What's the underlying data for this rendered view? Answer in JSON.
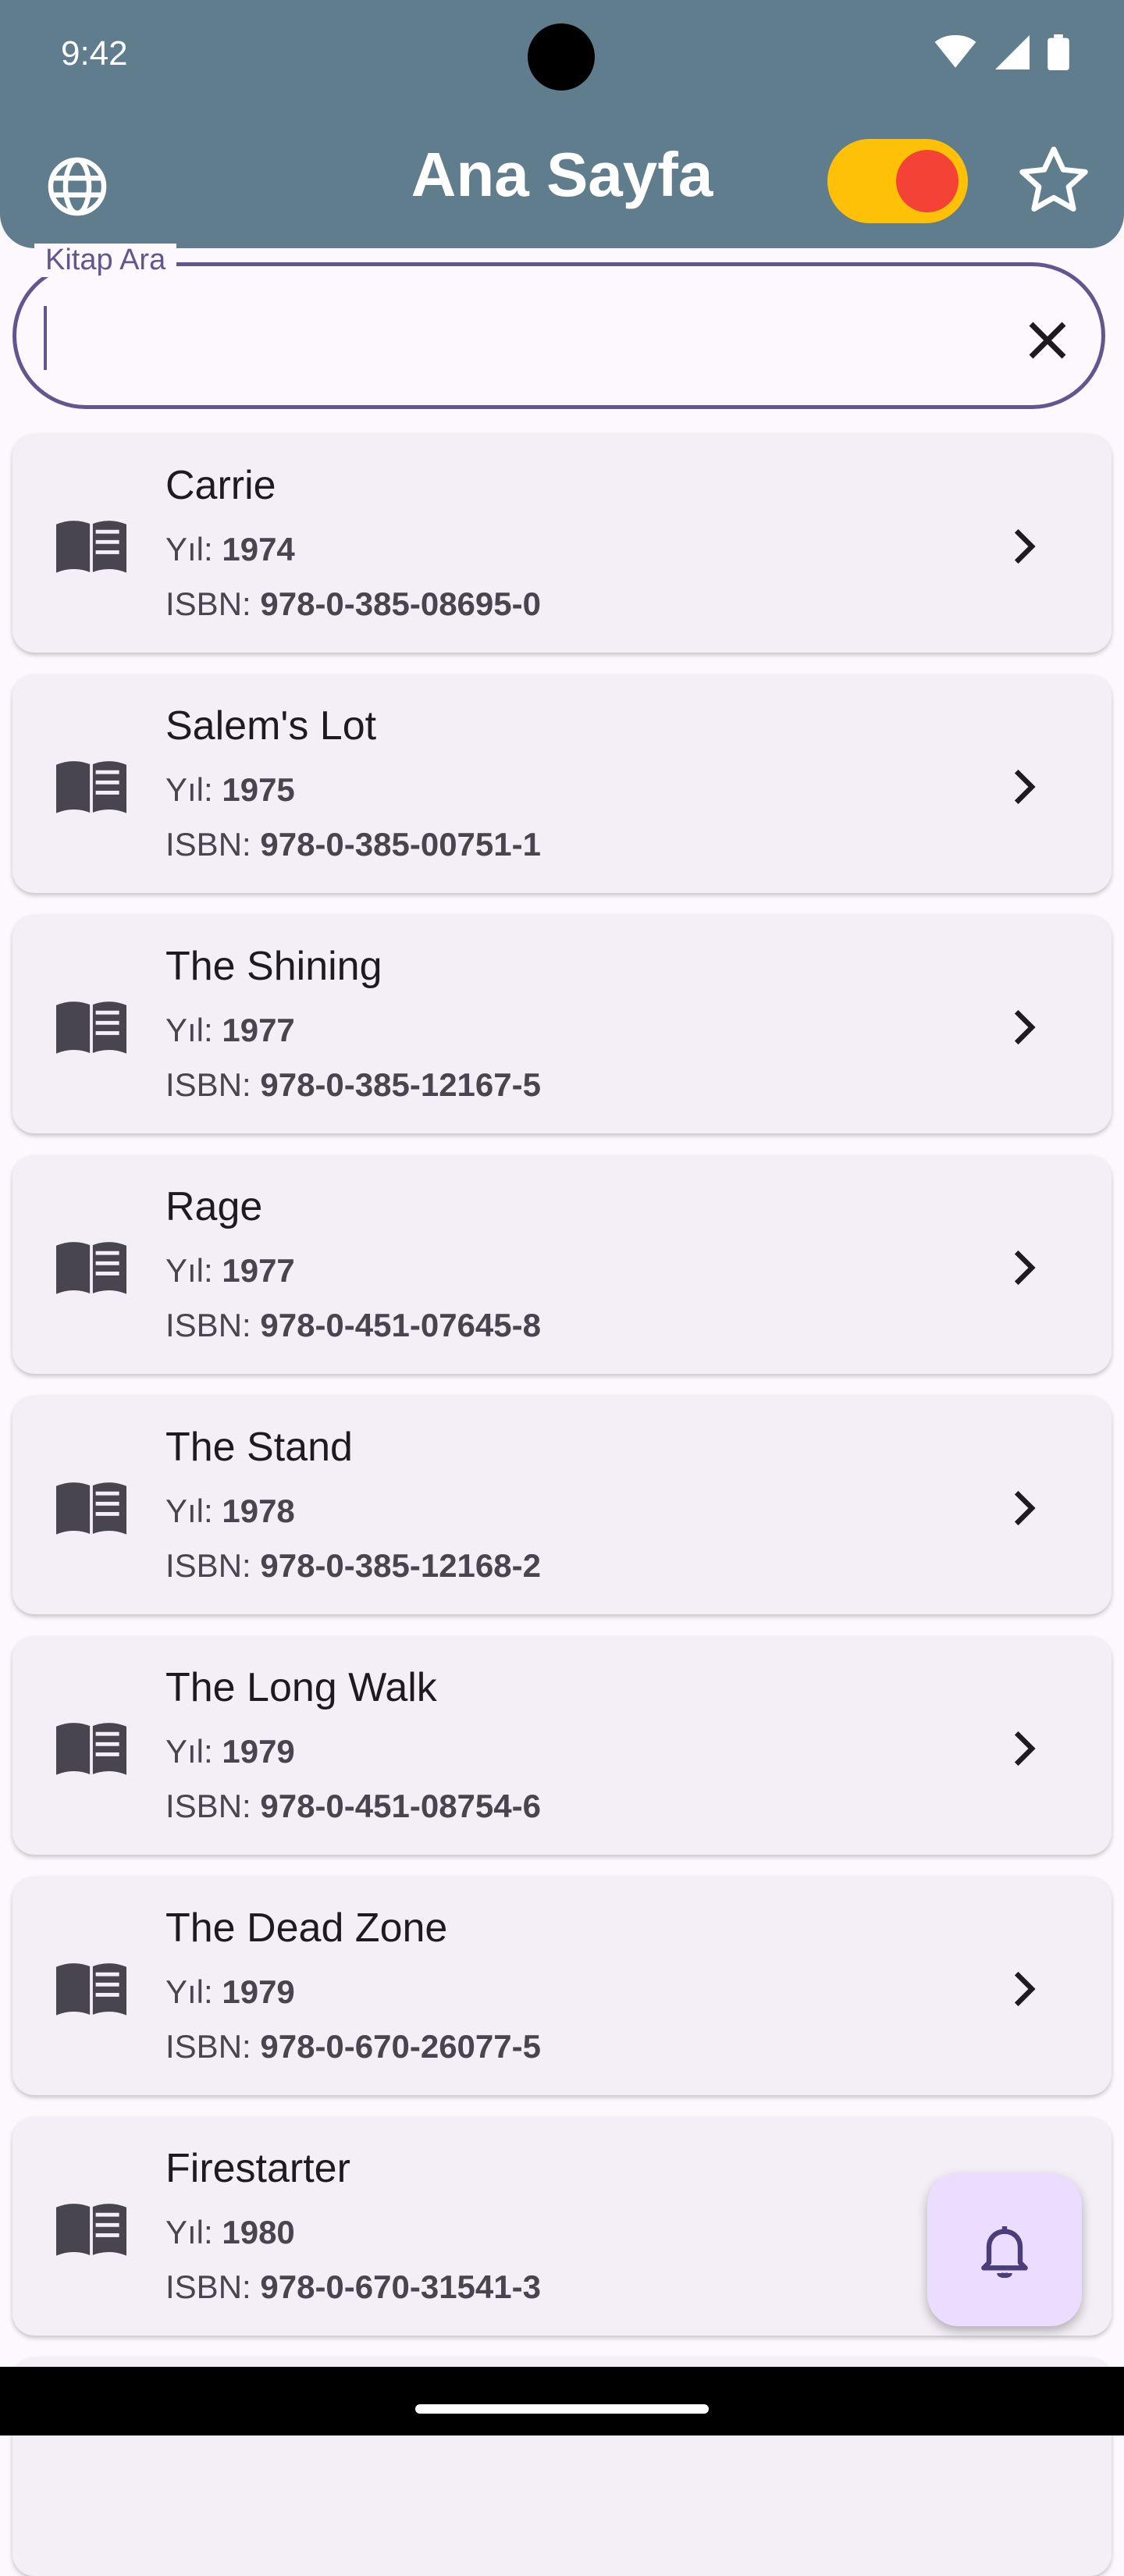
{
  "status_bar": {
    "time": "9:42"
  },
  "header": {
    "title": "Ana Sayfa"
  },
  "search": {
    "label": "Kitap Ara",
    "value": ""
  },
  "year_prefix": "Yıl:",
  "isbn_prefix": "ISBN:",
  "books": [
    {
      "title": "Carrie",
      "year": "1974",
      "isbn": "978-0-385-08695-0"
    },
    {
      "title": "Salem's Lot",
      "year": "1975",
      "isbn": "978-0-385-00751-1"
    },
    {
      "title": "The Shining",
      "year": "1977",
      "isbn": "978-0-385-12167-5"
    },
    {
      "title": "Rage",
      "year": "1977",
      "isbn": "978-0-451-07645-8"
    },
    {
      "title": "The Stand",
      "year": "1978",
      "isbn": "978-0-385-12168-2"
    },
    {
      "title": "The Long Walk",
      "year": "1979",
      "isbn": "978-0-451-08754-6"
    },
    {
      "title": "The Dead Zone",
      "year": "1979",
      "isbn": "978-0-670-26077-5"
    },
    {
      "title": "Firestarter",
      "year": "1980",
      "isbn": "978-0-670-31541-3"
    }
  ],
  "colors": {
    "header": "#5F7D8D",
    "accent": "#65558F",
    "toggle_track": "#FFC107",
    "toggle_thumb": "#F44336",
    "card": "#F4EFF6",
    "fab": "#EADDFF"
  },
  "icons": {
    "language": "globe-icon",
    "favorites": "star-outline-icon",
    "clear": "close-icon",
    "book": "menu-book-icon",
    "open": "chevron-right-icon",
    "notifications": "bell-icon"
  }
}
